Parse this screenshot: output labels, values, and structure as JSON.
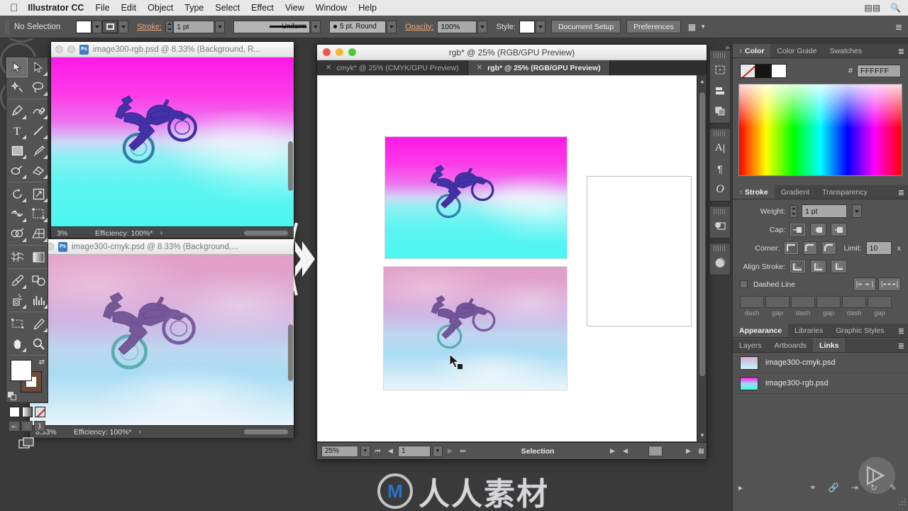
{
  "menubar": {
    "apple_icon": "apple-logo",
    "app_title": "Illustrator CC",
    "items": [
      "File",
      "Edit",
      "Object",
      "Type",
      "Select",
      "Effect",
      "View",
      "Window",
      "Help"
    ],
    "right_icons": [
      "battery-icon",
      "search-icon"
    ]
  },
  "control_bar": {
    "selection_status": "No Selection",
    "fill_label": "fill-swatch",
    "stroke_label": "Stroke:",
    "stroke_weight": "1 pt",
    "profile_value": "Uniform",
    "brush_value": "5 pt. Round",
    "opacity_label": "Opacity:",
    "opacity_value": "100%",
    "style_label": "Style:",
    "document_setup": "Document Setup",
    "preferences": "Preferences",
    "align_icon": "align-objects-icon",
    "panel_menu_icon": "panel-menu-icon"
  },
  "toolbox": {
    "tools": [
      "selection-tool",
      "direct-selection-tool",
      "magic-wand-tool",
      "lasso-tool",
      "pen-tool",
      "curvature-tool",
      "type-tool",
      "line-segment-tool",
      "rectangle-tool",
      "paintbrush-tool",
      "shaper-tool",
      "eraser-tool",
      "rotate-tool",
      "scale-tool",
      "width-tool",
      "free-transform-tool",
      "shape-builder-tool",
      "perspective-grid-tool",
      "mesh-tool",
      "gradient-tool",
      "eyedropper-tool",
      "blend-tool",
      "symbol-sprayer-tool",
      "column-graph-tool",
      "artboard-tool",
      "slice-tool",
      "hand-tool",
      "zoom-tool"
    ],
    "fill_stroke": {
      "fill_color": "#FFFFFF",
      "stroke_color": "#6B4A3A",
      "swap_icon": "swap-fill-stroke-icon",
      "default_icon": "default-fill-stroke-icon"
    },
    "color_modes": [
      "solid-color-swatch",
      "gradient-swatch",
      "none-swatch"
    ],
    "draw_modes": [
      "draw-normal-icon",
      "draw-behind-icon",
      "draw-inside-icon"
    ],
    "screen_mode": "change-screen-mode-icon"
  },
  "photoshop_windows": [
    {
      "title": "image300-rgb.psd @ 8.33% (Background, R...",
      "app_badge": "Ps",
      "zoom": "3%",
      "efficiency": "Efficiency: 100%*",
      "chevron": "expand-status-chevron"
    },
    {
      "title": "image300-cmyk.psd @ 8.33% (Background,...",
      "app_badge": "Ps",
      "zoom": "8.33%",
      "efficiency": "Efficiency: 100%*",
      "chevron": "expand-status-chevron"
    }
  ],
  "illustrator_window": {
    "title": "rgb* @ 25% (RGB/GPU Preview)",
    "traffic_lights": [
      "close-button",
      "minimize-button",
      "zoom-button"
    ],
    "tabs": [
      {
        "label": "cmyk* @ 25% (CMYK/GPU Preview)",
        "active": false,
        "close_icon": "close-tab-icon"
      },
      {
        "label": "rgb* @ 25% (RGB/GPU Preview)",
        "active": true,
        "close_icon": "close-tab-icon"
      }
    ],
    "status": {
      "zoom_value": "25%",
      "artboard_value": "1",
      "tool_status": "Selection",
      "first_icon": "first-artboard-icon",
      "prev_icon": "prev-artboard-icon",
      "next_icon": "next-artboard-icon",
      "last_icon": "last-artboard-icon"
    },
    "cursor": "selection-arrow-cursor"
  },
  "dock_strip": {
    "groups": [
      [
        "artboards-icon",
        "align-icon",
        "pathfinder-icon"
      ],
      [
        "character-icon",
        "paragraph-icon",
        "glyphs-icon"
      ],
      [
        "image-trace-icon"
      ],
      [
        "shape-builder-panel-icon"
      ]
    ],
    "collapse_icon": "collapse-panels-icon"
  },
  "panels": {
    "color_group": {
      "tabs": [
        "Color",
        "Color Guide",
        "Swatches"
      ],
      "active_tab": "Color",
      "hex_label": "#",
      "hex_value": "FFFFFF",
      "chips": [
        "none-chip",
        "black-chip",
        "white-chip"
      ],
      "menu_icon": "panel-menu-icon"
    },
    "stroke_group": {
      "tabs": [
        "Stroke",
        "Gradient",
        "Transparency"
      ],
      "active_tab": "Stroke",
      "weight_label": "Weight:",
      "weight_value": "1 pt",
      "cap_label": "Cap:",
      "cap_icons": [
        "butt-cap-icon",
        "round-cap-icon",
        "projecting-cap-icon"
      ],
      "corner_label": "Corner:",
      "corner_icons": [
        "miter-join-icon",
        "round-join-icon",
        "bevel-join-icon"
      ],
      "limit_label": "Limit:",
      "limit_value": "10",
      "limit_unit": "x",
      "align_label": "Align Stroke:",
      "align_icons": [
        "align-center-stroke-icon",
        "align-inside-stroke-icon",
        "align-outside-stroke-icon"
      ],
      "dashed_label": "Dashed Line",
      "dash_gap_labels": [
        "dash",
        "gap",
        "dash",
        "gap",
        "dash",
        "gap"
      ],
      "dash_preserve_icons": [
        "dash-exact-icon",
        "dash-adjust-icon"
      ],
      "menu_icon": "panel-menu-icon"
    },
    "appearance_group": {
      "tabs": [
        "Appearance",
        "Libraries",
        "Graphic Styles"
      ],
      "active_tab": "Appearance",
      "menu_icon": "panel-menu-icon"
    },
    "links_group": {
      "tabs": [
        "Layers",
        "Artboards",
        "Links"
      ],
      "active_tab": "Links",
      "menu_icon": "panel-menu-icon",
      "items": [
        {
          "name": "image300-cmyk.psd",
          "thumb": "cmyk-thumbnail"
        },
        {
          "name": "image300-rgb.psd",
          "thumb": "rgb-thumbnail"
        }
      ],
      "footer_icons": [
        "relink-icon",
        "go-to-link-icon",
        "update-link-icon",
        "edit-original-icon"
      ],
      "expand_icon": "expand-link-info-icon"
    }
  },
  "watermark": {
    "brand_text": "人人素材",
    "logo_glyph": "M"
  }
}
